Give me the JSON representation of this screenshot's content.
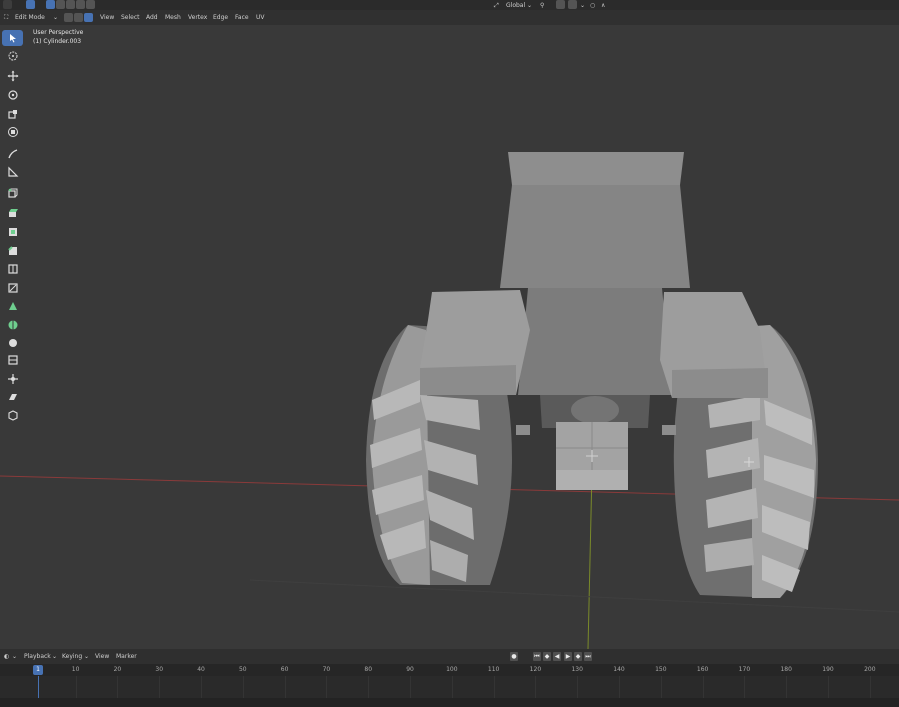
{
  "header": {
    "mode": "Edit Mode",
    "menu": [
      "View",
      "Select",
      "Add",
      "Mesh",
      "Vertex",
      "Edge",
      "Face",
      "UV"
    ],
    "orientation": "Global"
  },
  "viewport": {
    "view_name": "User Perspective",
    "object_name": "(1) Cylinder.003"
  },
  "toolbar": {
    "tools": [
      "select-box",
      "cursor",
      "move",
      "rotate",
      "scale",
      "transform",
      "annotate",
      "measure",
      "add-cube",
      "extrude-region",
      "inset-faces",
      "bevel",
      "loop-cut",
      "knife",
      "poly-build",
      "spin",
      "smooth",
      "edge-slide",
      "shrink-fatten",
      "shear",
      "rip-region"
    ]
  },
  "timeline": {
    "menu": [
      "Playback",
      "Keying",
      "View",
      "Marker"
    ],
    "current_frame": "1",
    "ticks": [
      "10",
      "20",
      "30",
      "40",
      "50",
      "60",
      "70",
      "80",
      "90",
      "100",
      "110",
      "120",
      "130",
      "140",
      "150",
      "160",
      "170",
      "180",
      "190",
      "200"
    ]
  }
}
